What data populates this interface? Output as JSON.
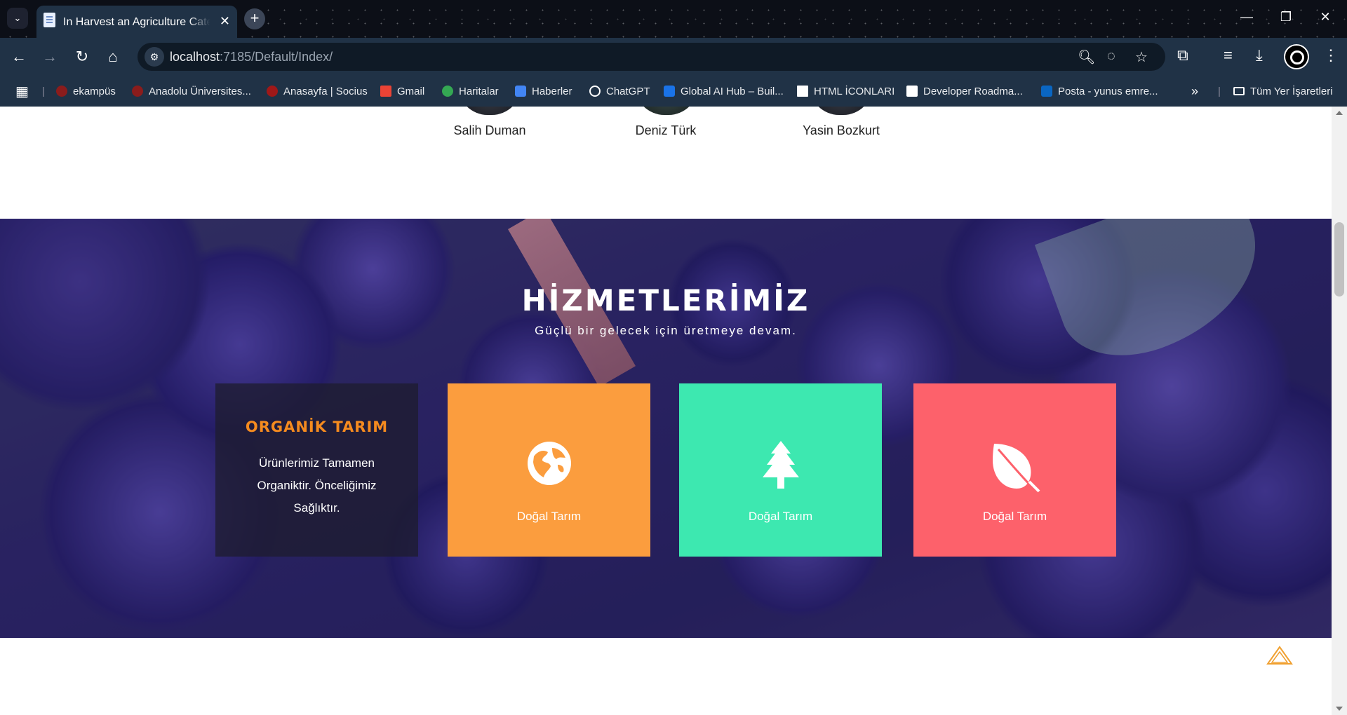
{
  "browser": {
    "tab_title": "In Harvest an Agriculture Categ",
    "url_host": "localhost",
    "url_rest": ":7185/Default/Index/",
    "bookmarks": [
      {
        "label": "ekampüs",
        "color": "#8b1c1c"
      },
      {
        "label": "Anadolu Üniversites...",
        "color": "#8b1c1c"
      },
      {
        "label": "Anasayfa | Socius",
        "color": "#a01818"
      },
      {
        "label": "Gmail",
        "color": "#ea4335"
      },
      {
        "label": "Haritalar",
        "color": "#34a853"
      },
      {
        "label": "Haberler",
        "color": "#4285f4"
      },
      {
        "label": "ChatGPT",
        "color": "#ffffff"
      },
      {
        "label": "Global AI Hub – Buil...",
        "color": "#1a73e8"
      },
      {
        "label": "HTML İCONLARI",
        "color": "#ffffff"
      },
      {
        "label": "Developer Roadma...",
        "color": "#ffffff"
      },
      {
        "label": "Posta - yunus emre...",
        "color": "#0a66c2"
      }
    ],
    "all_bookmarks": "Tüm Yer İşaretleri"
  },
  "team": {
    "members": [
      "Salih Duman",
      "Deniz Türk",
      "Yasin Bozkurt"
    ]
  },
  "services": {
    "title": "HİZMETLERİMİZ",
    "subtitle": "Güçlü bir gelecek için üretmeye devam.",
    "feature": {
      "title": "ORGANİK TARIM",
      "text": "Ürünlerimiz Tamamen Organiktir. Önceliğimiz Sağlıktır."
    },
    "cards": [
      {
        "label": "Doğal Tarım",
        "icon": "globe-icon",
        "color": "#fb9d3e"
      },
      {
        "label": "Doğal Tarım",
        "icon": "tree-icon",
        "color": "#3de8b0"
      },
      {
        "label": "Doğal Tarım",
        "icon": "leaf-icon",
        "color": "#fd616b"
      }
    ]
  },
  "accent_colors": {
    "orange": "#f58b1f",
    "scroll_top": "#f0a030"
  }
}
